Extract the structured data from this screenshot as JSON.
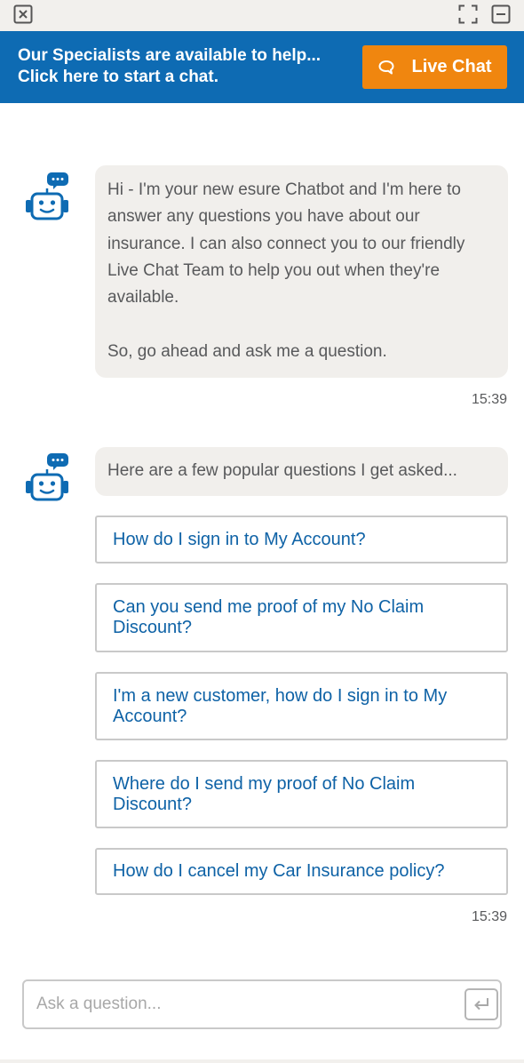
{
  "window": {
    "close_icon": "close-x-icon",
    "expand_icon": "expand-icon",
    "minimize_icon": "minimize-icon"
  },
  "banner": {
    "line1": "Our Specialists are available to help...",
    "line2": "Click here to start a chat.",
    "button_label": "Live Chat",
    "button_icon": "speech-bubble-icon",
    "background": "#0e6bb3",
    "button_color": "#f0860f"
  },
  "messages": [
    {
      "sender_icon": "robot-icon",
      "paragraphs": [
        "Hi - I'm your new esure Chatbot and I'm here to answer any questions you have about our insurance. I can also connect you to our friendly Live Chat Team to help you out when they're available.",
        "So, go ahead and ask me a question."
      ],
      "time": "15:39"
    },
    {
      "sender_icon": "robot-icon",
      "text": "Here are a few popular questions I get asked...",
      "quick_replies": [
        "How do I sign in to My Account?",
        "Can you send me proof of my No Claim Discount?",
        "I'm a new customer, how do I sign in to My Account?",
        "Where do I send my proof of No Claim Discount?",
        "How do I cancel my Car Insurance policy?"
      ],
      "time": "15:39"
    }
  ],
  "composer": {
    "placeholder": "Ask a question...",
    "value": "",
    "send_icon": "enter-return-icon"
  },
  "colors": {
    "accent_blue": "#0e6bb3",
    "link_blue": "#0e62a6",
    "bubble_bg": "#f1efec",
    "text_grey": "#58595b"
  }
}
